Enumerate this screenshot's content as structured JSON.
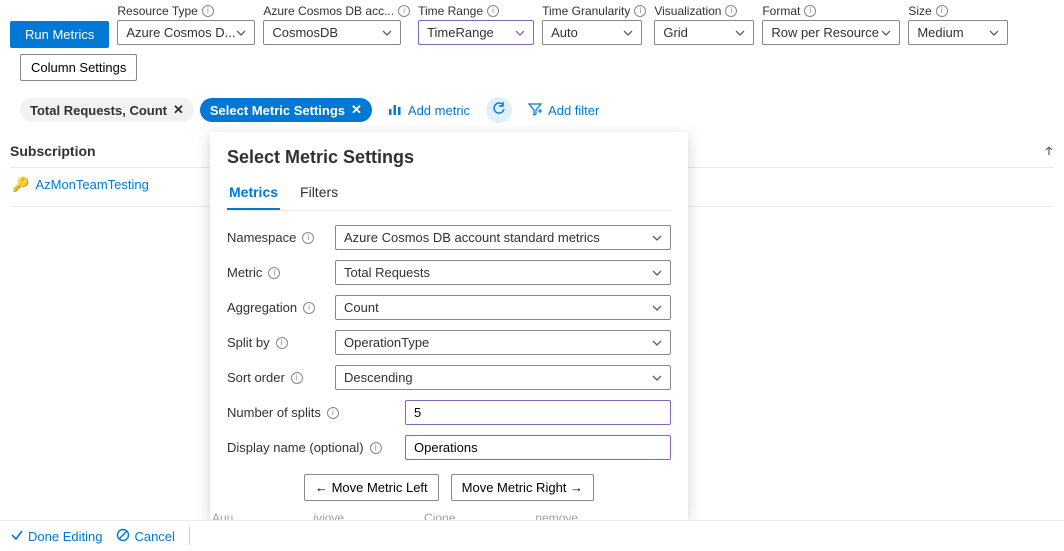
{
  "topbar": {
    "runMetrics": "Run Metrics",
    "columnSettings": "Column Settings",
    "fields": {
      "resourceType": {
        "label": "Resource Type",
        "value": "Azure Cosmos D..."
      },
      "account": {
        "label": "Azure Cosmos DB acc...",
        "value": "CosmosDB"
      },
      "timeRange": {
        "label": "Time Range",
        "value": "TimeRange"
      },
      "timeGranularity": {
        "label": "Time Granularity",
        "value": "Auto"
      },
      "visualization": {
        "label": "Visualization",
        "value": "Grid"
      },
      "format": {
        "label": "Format",
        "value": "Row per Resource"
      },
      "size": {
        "label": "Size",
        "value": "Medium"
      }
    }
  },
  "pills": {
    "totalRequests": "Total Requests, Count",
    "selectSettings": "Select Metric Settings",
    "addMetric": "Add metric",
    "addFilter": "Add filter"
  },
  "subscription": {
    "header": "Subscription",
    "item": "AzMonTeamTesting"
  },
  "panel": {
    "title": "Select Metric Settings",
    "tabs": {
      "metrics": "Metrics",
      "filters": "Filters"
    },
    "labels": {
      "namespace": "Namespace",
      "metric": "Metric",
      "aggregation": "Aggregation",
      "splitBy": "Split by",
      "sortOrder": "Sort order",
      "numberOfSplits": "Number of splits",
      "displayName": "Display name (optional)"
    },
    "values": {
      "namespace": "Azure Cosmos DB account standard metrics",
      "metric": "Total Requests",
      "aggregation": "Count",
      "splitBy": "OperationType",
      "sortOrder": "Descending",
      "numberOfSplits": "5",
      "displayName": "Operations"
    },
    "moveLeft": "←  Move Metric Left",
    "moveRight": "Move Metric Right  →"
  },
  "footer": {
    "doneEditing": "Done Editing",
    "cancel": "Cancel"
  },
  "ghost": {
    "add": "Auu",
    "move": "iviove",
    "clone": "Cione",
    "remove": "nemove"
  }
}
